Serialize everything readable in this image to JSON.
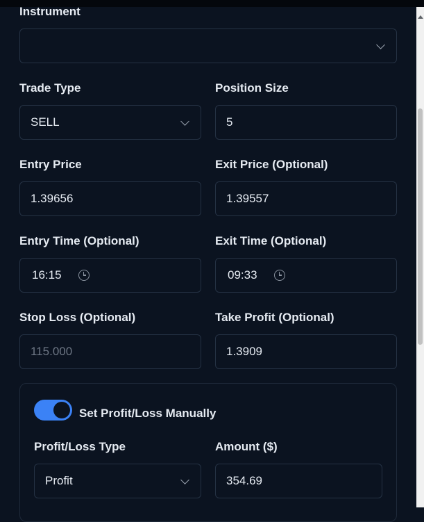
{
  "form": {
    "instrument": {
      "label": "Instrument",
      "value": ""
    },
    "trade_type": {
      "label": "Trade Type",
      "value": "SELL"
    },
    "position_size": {
      "label": "Position Size",
      "value": "5"
    },
    "entry_price": {
      "label": "Entry Price",
      "value": "1.39656"
    },
    "exit_price": {
      "label": "Exit Price (Optional)",
      "value": "1.39557"
    },
    "entry_time": {
      "label": "Entry Time (Optional)",
      "value": "16:15"
    },
    "exit_time": {
      "label": "Exit Time (Optional)",
      "value": "09:33"
    },
    "stop_loss": {
      "label": "Stop Loss (Optional)",
      "placeholder": "115.000",
      "value": ""
    },
    "take_profit": {
      "label": "Take Profit (Optional)",
      "value": "1.3909"
    }
  },
  "manual_pl": {
    "toggle_label": "Set Profit/Loss Manually",
    "toggle_on": true,
    "pl_type": {
      "label": "Profit/Loss Type",
      "value": "Profit"
    },
    "amount": {
      "label": "Amount ($)",
      "value": "354.69"
    }
  },
  "icons": {
    "select": "chevron-down-icon",
    "time": "clock-icon"
  },
  "colors": {
    "background": "#0b1320",
    "border": "#253244",
    "accent": "#3b82f6",
    "text": "#e6ebf2",
    "placeholder": "#6e7785"
  }
}
